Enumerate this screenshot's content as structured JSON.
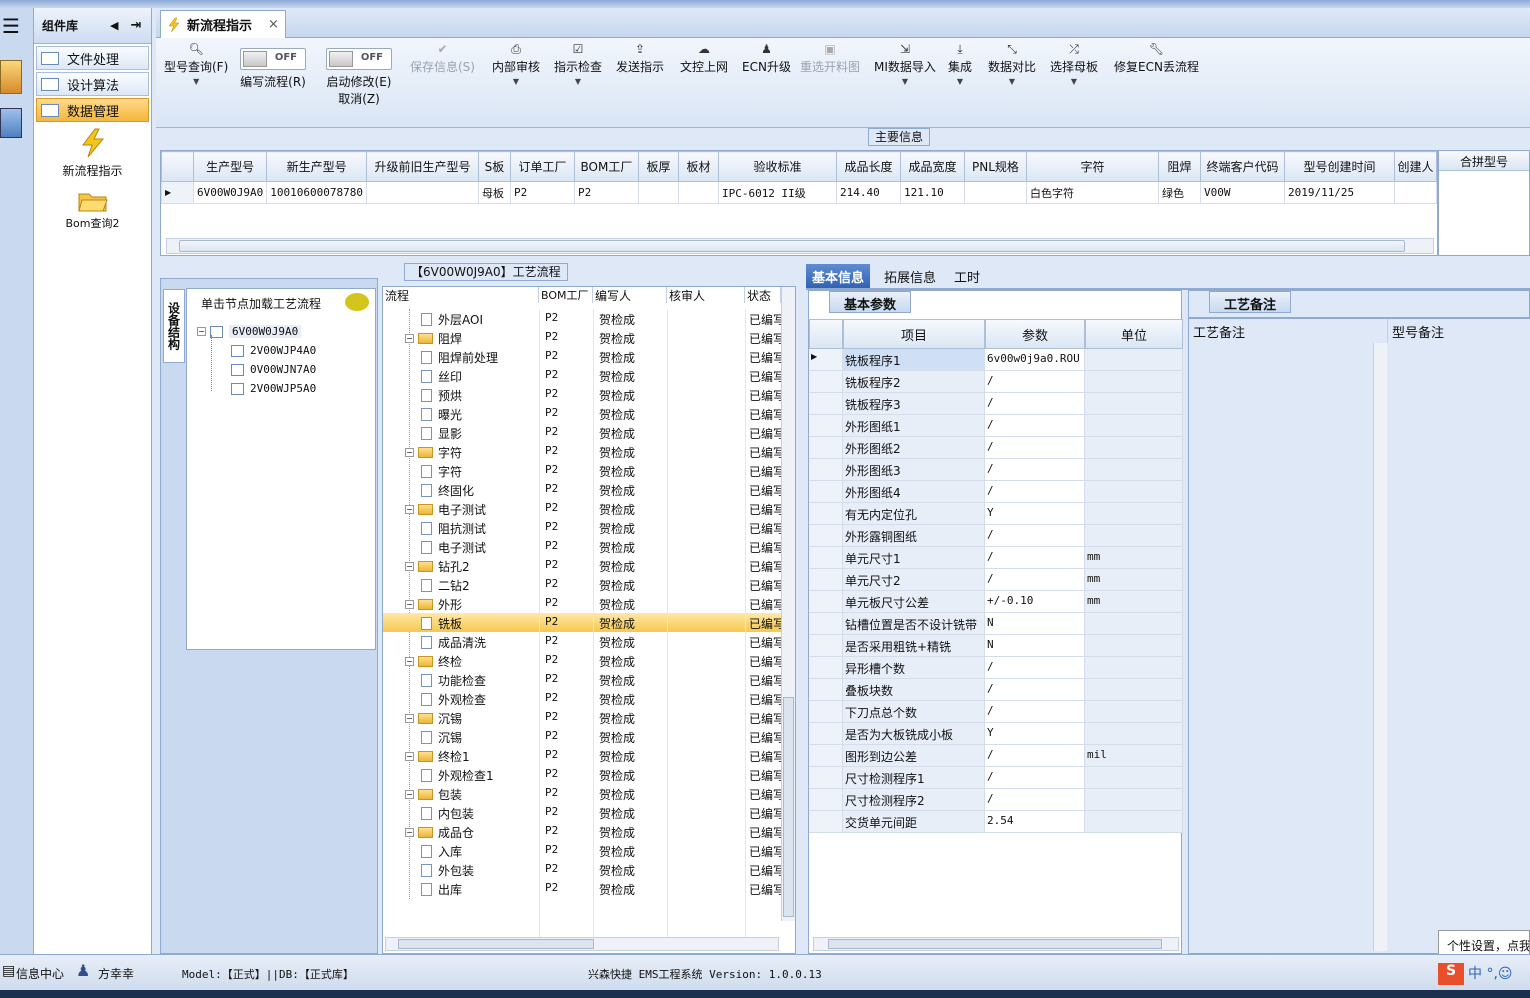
{
  "left_panel": {
    "title": "组件库",
    "items": [
      {
        "label": "文件处理"
      },
      {
        "label": "设计算法"
      },
      {
        "label": "数据管理"
      }
    ],
    "big_items": [
      {
        "label": "新流程指示",
        "icon": "lightning-icon"
      },
      {
        "label": "Bom查询2",
        "icon": "folder-open-icon"
      }
    ]
  },
  "doc_tab": {
    "label": "新流程指示",
    "close": "×"
  },
  "toolbar": {
    "model_query": "型号查询(F)",
    "write_flow": "编写流程(R)",
    "start_modify": "启动修改(E)",
    "cancel": "取消(Z)",
    "toggle_off": "OFF",
    "save_info": "保存信息(S)",
    "internal_review": "内部审核",
    "instruction_check": "指示检查",
    "send_instruction": "发送指示",
    "doc_online": "文控上网",
    "ecn_upgrade": "ECN升级",
    "reselect_cut": "重选开料图",
    "mi_import": "MI数据导入",
    "integrate": "集成",
    "data_compare": "数据对比",
    "select_mother": "选择母板",
    "repair_ecn": "修复ECN丢流程"
  },
  "main_info": {
    "title": "主要信息",
    "columns": [
      "生产型号",
      "新生产型号",
      "升级前旧生产型号",
      "S板",
      "订单工厂",
      "BOM工厂",
      "板厚",
      "板材",
      "验收标准",
      "成品长度",
      "成品宽度",
      "PNL规格",
      "字符",
      "阻焊",
      "终端客户代码",
      "型号创建时间",
      "创建人"
    ],
    "row": [
      "6V00W0J9A0",
      "10010600078780",
      "",
      "母板",
      "P2",
      "P2",
      "",
      "",
      "IPC-6012 II级",
      "214.40",
      "121.10",
      "",
      "白色字符",
      "绿色",
      "V00W",
      "2019/11/25",
      ""
    ],
    "merge_header": "合拼型号"
  },
  "left_tree": {
    "vertical_tab": "设备结构",
    "hint": "单击节点加载工艺流程",
    "root": "6V00W0J9A0",
    "children": [
      "2V00WJP4A0",
      "0V00WJN7A0",
      "2V00WJP5A0"
    ]
  },
  "flow": {
    "title": "【6V00W0J9A0】工艺流程",
    "columns": {
      "name": "流程",
      "bom": "BOM工厂",
      "writer": "编写人",
      "reviewer": "核审人",
      "status": "状态"
    },
    "rows": [
      {
        "name": "外层AOI",
        "type": "doc",
        "level": 2,
        "bom": "P2",
        "writer": "贺检成",
        "status": "已编写"
      },
      {
        "name": "阻焊",
        "type": "folder",
        "level": 1,
        "bom": "P2",
        "writer": "贺检成",
        "status": "已编写"
      },
      {
        "name": "阻焊前处理",
        "type": "doc",
        "level": 2,
        "bom": "P2",
        "writer": "贺检成",
        "status": "已编写"
      },
      {
        "name": "丝印",
        "type": "doc",
        "level": 2,
        "bom": "P2",
        "writer": "贺检成",
        "status": "已编写"
      },
      {
        "name": "预烘",
        "type": "doc",
        "level": 2,
        "bom": "P2",
        "writer": "贺检成",
        "status": "已编写"
      },
      {
        "name": "曝光",
        "type": "doc",
        "level": 2,
        "bom": "P2",
        "writer": "贺检成",
        "status": "已编写"
      },
      {
        "name": "显影",
        "type": "doc",
        "level": 2,
        "bom": "P2",
        "writer": "贺检成",
        "status": "已编写"
      },
      {
        "name": "字符",
        "type": "folder",
        "level": 1,
        "bom": "P2",
        "writer": "贺检成",
        "status": "已编写"
      },
      {
        "name": "字符",
        "type": "doc",
        "level": 2,
        "bom": "P2",
        "writer": "贺检成",
        "status": "已编写"
      },
      {
        "name": "终固化",
        "type": "doc",
        "level": 2,
        "bom": "P2",
        "writer": "贺检成",
        "status": "已编写"
      },
      {
        "name": "电子测试",
        "type": "folder",
        "level": 1,
        "bom": "P2",
        "writer": "贺检成",
        "status": "已编写"
      },
      {
        "name": "阻抗测试",
        "type": "doc",
        "level": 2,
        "bom": "P2",
        "writer": "贺检成",
        "status": "已编写"
      },
      {
        "name": "电子测试",
        "type": "doc",
        "level": 2,
        "bom": "P2",
        "writer": "贺检成",
        "status": "已编写"
      },
      {
        "name": "钻孔2",
        "type": "folder",
        "level": 1,
        "bom": "P2",
        "writer": "贺检成",
        "status": "已编写"
      },
      {
        "name": "二钻2",
        "type": "doc",
        "level": 2,
        "bom": "P2",
        "writer": "贺检成",
        "status": "已编写"
      },
      {
        "name": "外形",
        "type": "folder",
        "level": 1,
        "bom": "P2",
        "writer": "贺检成",
        "status": "已编写"
      },
      {
        "name": "铣板",
        "type": "doc",
        "level": 2,
        "bom": "P2",
        "writer": "贺检成",
        "status": "已编写",
        "selected": true
      },
      {
        "name": "成品清洗",
        "type": "doc",
        "level": 2,
        "bom": "P2",
        "writer": "贺检成",
        "status": "已编写"
      },
      {
        "name": "终检",
        "type": "folder",
        "level": 1,
        "bom": "P2",
        "writer": "贺检成",
        "status": "已编写"
      },
      {
        "name": "功能检查",
        "type": "doc",
        "level": 2,
        "bom": "P2",
        "writer": "贺检成",
        "status": "已编写"
      },
      {
        "name": "外观检查",
        "type": "doc",
        "level": 2,
        "bom": "P2",
        "writer": "贺检成",
        "status": "已编写"
      },
      {
        "name": "沉锡",
        "type": "folder",
        "level": 1,
        "bom": "P2",
        "writer": "贺检成",
        "status": "已编写"
      },
      {
        "name": "沉锡",
        "type": "doc",
        "level": 2,
        "bom": "P2",
        "writer": "贺检成",
        "status": "已编写"
      },
      {
        "name": "终检1",
        "type": "folder",
        "level": 1,
        "bom": "P2",
        "writer": "贺检成",
        "status": "已编写"
      },
      {
        "name": "外观检查1",
        "type": "doc",
        "level": 2,
        "bom": "P2",
        "writer": "贺检成",
        "status": "已编写"
      },
      {
        "name": "包装",
        "type": "folder",
        "level": 1,
        "bom": "P2",
        "writer": "贺检成",
        "status": "已编写"
      },
      {
        "name": "内包装",
        "type": "doc",
        "level": 2,
        "bom": "P2",
        "writer": "贺检成",
        "status": "已编写"
      },
      {
        "name": "成品仓",
        "type": "folder",
        "level": 1,
        "bom": "P2",
        "writer": "贺检成",
        "status": "已编写"
      },
      {
        "name": "入库",
        "type": "doc",
        "level": 2,
        "bom": "P2",
        "writer": "贺检成",
        "status": "已编写"
      },
      {
        "name": "外包装",
        "type": "doc",
        "level": 2,
        "bom": "P2",
        "writer": "贺检成",
        "status": "已编写"
      },
      {
        "name": "出库",
        "type": "doc",
        "level": 2,
        "bom": "P2",
        "writer": "贺检成",
        "status": "已编写"
      }
    ]
  },
  "right_tabs": [
    "基本信息",
    "拓展信息",
    "工时"
  ],
  "basic_params": {
    "tab": "基本参数",
    "columns": [
      "项目",
      "参数",
      "单位"
    ],
    "rows": [
      [
        "铣板程序1",
        "6v00w0j9a0.ROU",
        ""
      ],
      [
        "铣板程序2",
        "/",
        ""
      ],
      [
        "铣板程序3",
        "/",
        ""
      ],
      [
        "外形图纸1",
        "/",
        ""
      ],
      [
        "外形图纸2",
        "/",
        ""
      ],
      [
        "外形图纸3",
        "/",
        ""
      ],
      [
        "外形图纸4",
        "/",
        ""
      ],
      [
        "有无内定位孔",
        "Y",
        ""
      ],
      [
        "外形露铜图纸",
        "/",
        ""
      ],
      [
        "单元尺寸1",
        "/",
        "mm"
      ],
      [
        "单元尺寸2",
        "/",
        "mm"
      ],
      [
        "单元板尺寸公差",
        "+/-0.10",
        "mm"
      ],
      [
        "钻槽位置是否不设计铣带",
        "N",
        ""
      ],
      [
        "是否采用粗铣+精铣",
        "N",
        ""
      ],
      [
        "异形槽个数",
        "/",
        ""
      ],
      [
        "叠板块数",
        "/",
        ""
      ],
      [
        "下刀点总个数",
        "/",
        ""
      ],
      [
        "是否为大板铣成小板",
        "Y",
        ""
      ],
      [
        "图形到边公差",
        "/",
        "mil"
      ],
      [
        "尺寸检测程序1",
        "/",
        ""
      ],
      [
        "尺寸检测程序2",
        "/",
        ""
      ],
      [
        "交货单元间距",
        "2.54",
        ""
      ]
    ]
  },
  "notes": {
    "tab": "工艺备注",
    "col1": "工艺备注",
    "col2": "型号备注"
  },
  "tooltip": "个性设置，点我",
  "status": {
    "info_center": "信息中心",
    "user": "方幸幸",
    "model": "Model:【正式】||DB:【正式库】",
    "app": "兴森快捷 EMS工程系统 Version: 1.0.0.13"
  },
  "colors": {
    "accent": "#2f63b3",
    "selection": "#f7c850",
    "panel": "#dfe8f6"
  }
}
